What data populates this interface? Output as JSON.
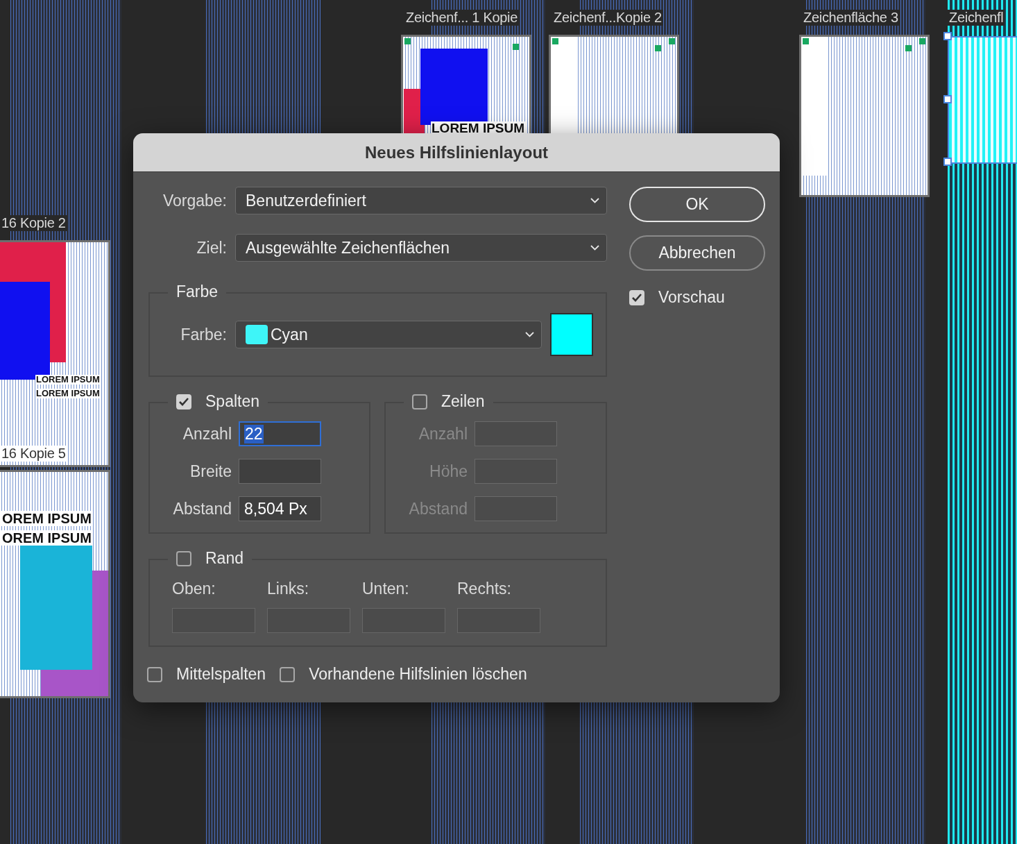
{
  "canvas": {
    "artboards": [
      {
        "label": "Zeichenf... 1 Kopie",
        "kind": "blue-red",
        "selected": false,
        "texts": [
          "LOREM IPSUM"
        ]
      },
      {
        "label": "Zeichenf...Kopie 2",
        "kind": "plain-dots",
        "selected": false
      },
      {
        "label": "Zeichenfläche 3",
        "kind": "plain-dots",
        "selected": false
      },
      {
        "label": "Zeichenfl",
        "kind": "cyan-guides",
        "selected": true
      },
      {
        "label": "16 Kopie 2",
        "kind": "red-blue-small",
        "selected": false,
        "texts": [
          "LOREM IPSUM",
          "LOREM IPSUM"
        ]
      },
      {
        "label": "16 Kopie 5",
        "kind": "cyan-purple",
        "selected": false,
        "texts": [
          "OREM IPSUM",
          "OREM IPSUM"
        ]
      }
    ]
  },
  "dialog": {
    "title": "Neues Hilfslinienlayout",
    "preset": {
      "label": "Vorgabe:",
      "value": "Benutzerdefiniert"
    },
    "target": {
      "label": "Ziel:",
      "value": "Ausgewählte Zeichenflächen"
    },
    "color_group": {
      "legend": "Farbe",
      "label": "Farbe:",
      "value": "Cyan"
    },
    "columns": {
      "label": "Spalten",
      "checked": true,
      "fields": [
        {
          "label": "Anzahl",
          "value": "22",
          "focused": true
        },
        {
          "label": "Breite",
          "focused": false
        },
        {
          "label": "Abstand",
          "value": "8,504 Px",
          "focused": false
        }
      ]
    },
    "rows": {
      "label": "Zeilen",
      "checked": false,
      "fields": [
        {
          "label": "Anzahl",
          "focused": false
        },
        {
          "label": "Höhe",
          "focused": false
        },
        {
          "label": "Abstand",
          "focused": false
        }
      ]
    },
    "margin": {
      "label": "Rand",
      "checked": false,
      "fields": [
        {
          "label": "Oben:"
        },
        {
          "label": "Links:"
        },
        {
          "label": "Unten:"
        },
        {
          "label": "Rechts:"
        }
      ]
    },
    "options": [
      {
        "label": "Mittelspalten",
        "checked": false
      },
      {
        "label": "Vorhandene Hilfslinien löschen",
        "checked": false
      }
    ],
    "buttons": [
      {
        "label": "OK",
        "default": true
      },
      {
        "label": "Abbrechen",
        "default": false
      }
    ],
    "preview": {
      "label": "Vorschau",
      "checked": true
    }
  }
}
